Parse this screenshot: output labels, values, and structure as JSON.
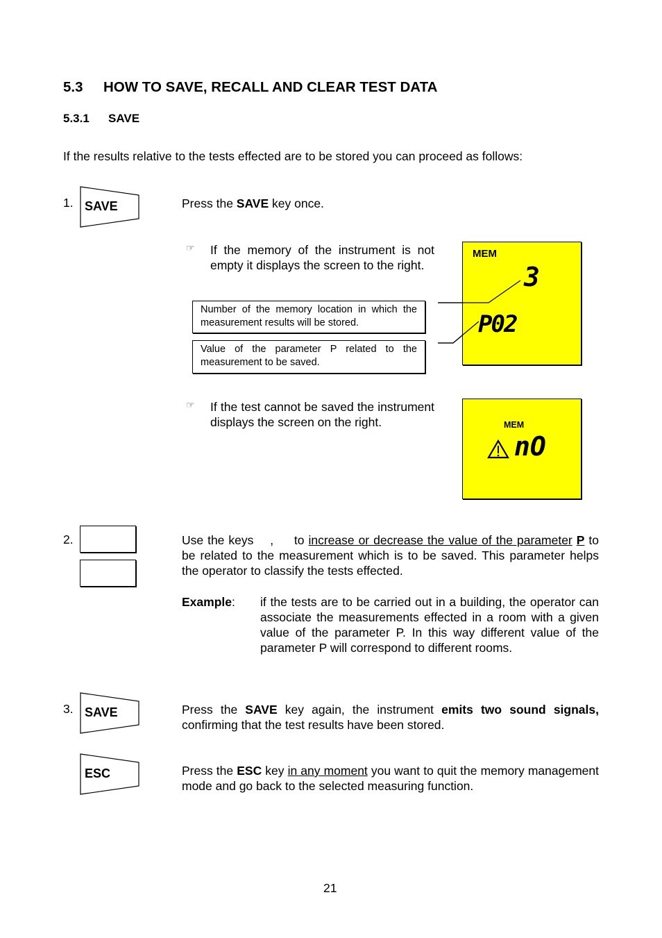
{
  "section": {
    "number": "5.3",
    "title": "HOW TO SAVE, RECALL AND CLEAR TEST DATA"
  },
  "subsection": {
    "number": "5.3.1",
    "title": "SAVE"
  },
  "intro": "If the results relative to the tests effected are to be stored you can proceed as follows:",
  "step1": {
    "number": "1.",
    "key_label": "SAVE",
    "text_pre": "Press the ",
    "text_bold": "SAVE",
    "text_post": " key once.",
    "note1": {
      "icon": "pointing-hand-icon",
      "text": "If the memory of the instrument is not empty it displays the screen to the right."
    },
    "callout_location": "Number of the memory location in which the  measurement results will be stored.",
    "callout_parameter": "Value of the parameter P related to the measurement to be saved.",
    "lcd1": {
      "mem_label": "MEM",
      "location_value": "3",
      "parameter_value": "P02",
      "color": "#ffff00"
    },
    "note2": {
      "icon": "pointing-hand-icon",
      "text": "If the test cannot be saved the instrument displays the screen on the right."
    },
    "lcd2": {
      "mem_label": "MEM",
      "warning_icon": "warning-triangle-icon",
      "value": "nO",
      "color": "#ffff00"
    }
  },
  "step2": {
    "number": "2.",
    "text_a": "Use the keys    ,     to ",
    "text_underlined": "increase or decrease the value of the parameter",
    "text_p": "P",
    "text_b": " to be related to the measurement which is to be saved. This parameter helps the operator to classify the tests effected.",
    "example_label": "Example",
    "example_colon": ":",
    "example_text": "if the tests are to be carried out in a building, the operator can associate the measurements effected in a room with a given value of the parameter P. In this way different value of the parameter P will correspond to different rooms."
  },
  "step3": {
    "number": "3.",
    "key_label": "SAVE",
    "text_a": "Press the ",
    "text_bold1": "SAVE",
    "text_b": " key again, the instrument ",
    "text_bold2": "emits two sound signals,",
    "text_c": " confirming that the test results have been stored."
  },
  "esc": {
    "key_label": "ESC",
    "text_a": "Press the ",
    "text_bold": "ESC",
    "text_b": " key ",
    "text_underlined": "in any moment",
    "text_c": " you want to quit the memory management mode and go back to the selected measuring function."
  },
  "page_number": "21"
}
